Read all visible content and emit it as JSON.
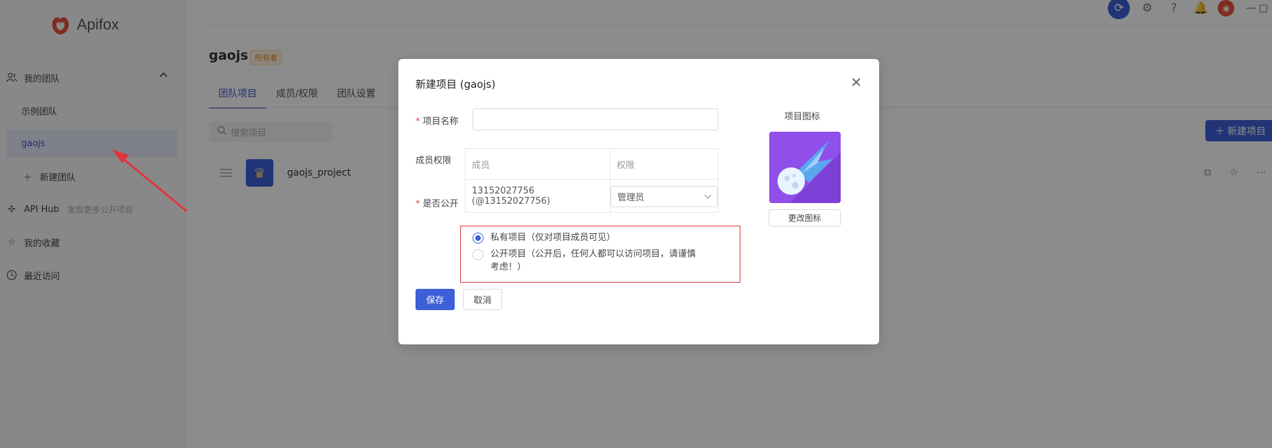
{
  "app": {
    "name": "Apifox"
  },
  "sidebar": {
    "my_team": "我的团队",
    "teams": [
      "示例团队",
      "gaojs"
    ],
    "new_team": "新建团队",
    "api_hub": "API Hub",
    "api_hub_hint": "发现更多公开项目",
    "favorites": "我的收藏",
    "recent": "最近访问"
  },
  "header": {
    "team_name": "gaojs",
    "owner_badge": "所有者",
    "tabs": [
      "团队项目",
      "成员/权限",
      "团队设置"
    ],
    "window_controls": "— □"
  },
  "projects": {
    "search_placeholder": "搜索项目",
    "new_project_label": "新建项目",
    "items": [
      {
        "name": "gaojs_project"
      }
    ]
  },
  "modal": {
    "title": "新建项目 (gaojs)",
    "name_label": "项目名称",
    "name_value": "",
    "members_label": "成员权限",
    "table_headers": [
      "成员",
      "权限"
    ],
    "member": "13152027756 (@13152027756)",
    "permission": "管理员",
    "visibility_label": "是否公开",
    "visibility_options": [
      {
        "label": "私有项目（仅对项目成员可见）",
        "checked": true
      },
      {
        "label": "公开项目（公开后，任何人都可以访问项目，请谨慎考虑！）",
        "checked": false
      }
    ],
    "save": "保存",
    "cancel": "取消",
    "icon_label": "项目图标",
    "change_icon": "更改图标"
  },
  "colors": {
    "accent": "#3d5fd8",
    "highlight_box": "#e0353a",
    "project_icon_bg": "#8f4fe8"
  }
}
